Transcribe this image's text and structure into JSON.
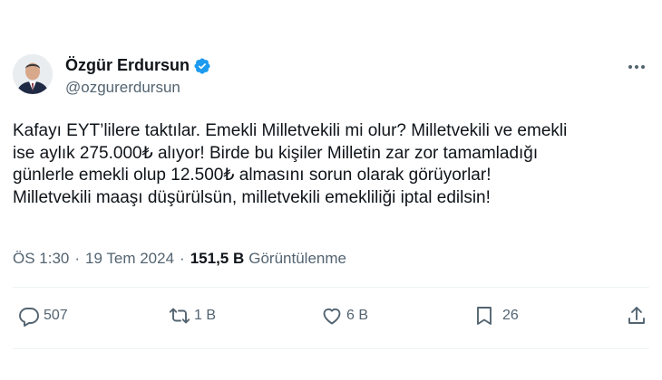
{
  "author": {
    "display_name": "Özgür Erdursun",
    "handle": "@ozgurerdursun",
    "verified": true
  },
  "tweet": {
    "lines": [
      "Kafayı EYT’lilere taktılar. Emekli Milletvekili mi olur? Milletvekili ve emekli",
      "ise aylık 275.000₺ alıyor! Birde bu kişiler Milletin zar zor tamamladığı",
      "günlerle emekli olup 12.500₺ almasını sorun olarak görüyorlar!",
      "Milletvekili maaşı düşürülsün, milletvekili emekliliği iptal edilsin!"
    ],
    "time": "ÖS 1:30",
    "separator": "·",
    "date": "19 Tem 2024",
    "views_count": "151,5 B",
    "views_label": "Görüntülenme"
  },
  "actions": {
    "reply_count": "507",
    "retweet_count": "1 B",
    "like_count": "6 B",
    "bookmark_count": "26"
  },
  "icons": [
    "verified-badge-icon",
    "more-icon",
    "reply-icon",
    "retweet-icon",
    "like-icon",
    "bookmark-icon",
    "share-icon"
  ],
  "colors": {
    "text": "#0f1419",
    "secondary": "#536471",
    "verified": "#1d9bf0"
  }
}
